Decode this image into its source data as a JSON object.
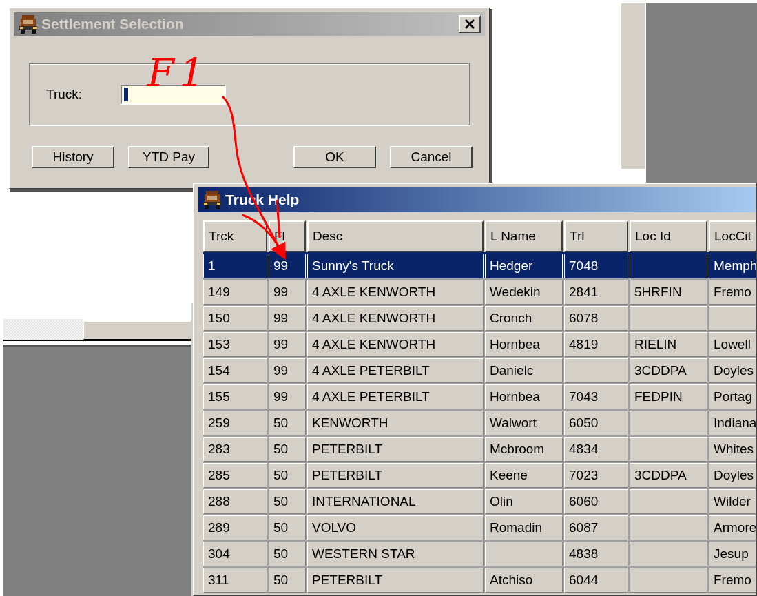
{
  "settlement_window": {
    "title": "Settlement Selection",
    "active": false,
    "field": {
      "label": "Truck:",
      "focused": true
    },
    "buttons": [
      "History",
      "YTD Pay",
      "OK",
      "Cancel"
    ]
  },
  "truck_help_window": {
    "title": "Truck Help",
    "active": true,
    "columns": [
      "Trck",
      "Fl",
      "Desc",
      "L Name",
      "Trl",
      "Loc Id",
      "LocCit"
    ],
    "rows": [
      {
        "selected": true,
        "cells": [
          "1",
          "99",
          "Sunny's Truck",
          "Hedger",
          "7048",
          null,
          "Memph"
        ]
      },
      {
        "selected": false,
        "cells": [
          "149",
          "99",
          "4 AXLE KENWORTH",
          "Wedekin",
          "2841",
          "5HRFIN",
          "Fremo"
        ]
      },
      {
        "selected": false,
        "cells": [
          "150",
          "99",
          "4 AXLE KENWORTH",
          "Cronch",
          "6078",
          null,
          null
        ]
      },
      {
        "selected": false,
        "cells": [
          "153",
          "99",
          "4 AXLE KENWORTH",
          "Hornbea",
          "4819",
          "RIELIN",
          "Lowell"
        ]
      },
      {
        "selected": false,
        "cells": [
          "154",
          "99",
          "4 AXLE PETERBILT",
          "Danielc",
          null,
          "3CDDPA",
          "Doyles"
        ]
      },
      {
        "selected": false,
        "cells": [
          "155",
          "99",
          "4 AXLE PETERBILT",
          "Hornbea",
          "7043",
          "FEDPIN",
          "Portag"
        ]
      },
      {
        "selected": false,
        "cells": [
          "259",
          "50",
          "KENWORTH",
          "Walwort",
          "6050",
          null,
          "Indiana"
        ]
      },
      {
        "selected": false,
        "cells": [
          "283",
          "50",
          "PETERBILT",
          "Mcbroom",
          "4834",
          null,
          "Whites"
        ]
      },
      {
        "selected": false,
        "cells": [
          "285",
          "50",
          "PETERBILT",
          "Keene",
          "7023",
          "3CDDPA",
          "Doyles"
        ]
      },
      {
        "selected": false,
        "cells": [
          "288",
          "50",
          "INTERNATIONAL",
          "Olin",
          "6060",
          null,
          "Wilder"
        ]
      },
      {
        "selected": false,
        "cells": [
          "289",
          "50",
          "VOLVO",
          "Romadin",
          "6087",
          null,
          "Armore"
        ]
      },
      {
        "selected": false,
        "cells": [
          "304",
          "50",
          "WESTERN STAR",
          null,
          "4838",
          null,
          "Jesup"
        ]
      },
      {
        "selected": false,
        "cells": [
          "311",
          "50",
          "PETERBILT",
          "Atchiso",
          "6044",
          null,
          "Fremo"
        ]
      }
    ]
  },
  "annotation": {
    "text": "F1"
  }
}
